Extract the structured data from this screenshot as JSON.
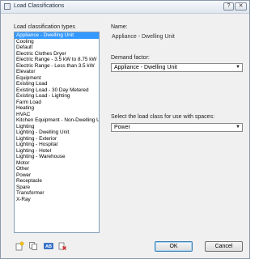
{
  "window": {
    "title": "Load Classifications",
    "help_label": "?",
    "close_label": "✕"
  },
  "list": {
    "label": "Load classification types",
    "items": [
      "Appliance - Dwelling Unit",
      "Cooling",
      "Default",
      "Electric Clothes Dryer",
      "Electric Range - 3.5 kW to 8.75 kW",
      "Electric Range - Less than 3.5 kW",
      "Elevator",
      "Equipment",
      "Existing Load",
      "Existing Load - 30 Day Metered",
      "Existing Load - Lighting",
      "Farm Load",
      "Heating",
      "HVAC",
      "Kitchen Equipment - Non-Dwelling Unit",
      "Lighting",
      "Lighting - Dwelling Unit",
      "Lighting - Exterior",
      "Lighting - Hospital",
      "Lighting - Hotel",
      "Lighting - Warehouse",
      "Motor",
      "Other",
      "Power",
      "Receptacle",
      "Spare",
      "Transformer",
      "X-Ray"
    ],
    "selected_index": 0
  },
  "details": {
    "name_label": "Name:",
    "name_value": "Appliance - Dwelling Unit",
    "demand_label": "Demand factor:",
    "demand_value": "Appliance - Dwelling Unit",
    "load_class_label": "Select the load class for use with spaces:",
    "load_class_value": "Power"
  },
  "toolbar": {
    "icons": [
      "new-icon",
      "duplicate-icon",
      "rename-icon",
      "delete-icon"
    ],
    "rename_text": "AB"
  },
  "buttons": {
    "ok": "OK",
    "cancel": "Cancel"
  }
}
